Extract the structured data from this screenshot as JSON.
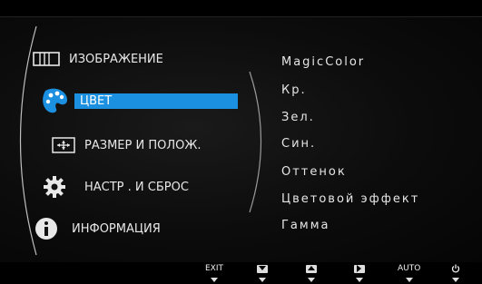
{
  "menu": {
    "items": [
      {
        "label": "ИЗОБРАЖЕНИЕ",
        "icon": "picture-icon",
        "selected": false
      },
      {
        "label": "ЦВЕТ",
        "icon": "color-palette-icon",
        "selected": true
      },
      {
        "label": "РАЗМЕР И ПОЛОЖ.",
        "icon": "size-position-icon",
        "selected": false
      },
      {
        "label": "НАСТР . И СБРОС",
        "icon": "gear-icon",
        "selected": false
      },
      {
        "label": "ИНФОРМАЦИЯ",
        "icon": "info-icon",
        "selected": false
      }
    ]
  },
  "submenu": {
    "items": [
      "MagicColor",
      "Кр.",
      "Зел.",
      "Син.",
      "Оттенок",
      "Цветовой эффект",
      "Гамма"
    ]
  },
  "buttons": {
    "exit_label": "EXIT",
    "auto_label": "AUTO",
    "down_icon": "down-arrow-icon",
    "up_icon": "up-arrow-icon",
    "right_icon": "right-arrow-icon",
    "power_icon": "power-icon"
  },
  "colors": {
    "accent": "#1b8fe0",
    "text": "#e8e8e8",
    "background": "#0c0c0c"
  }
}
